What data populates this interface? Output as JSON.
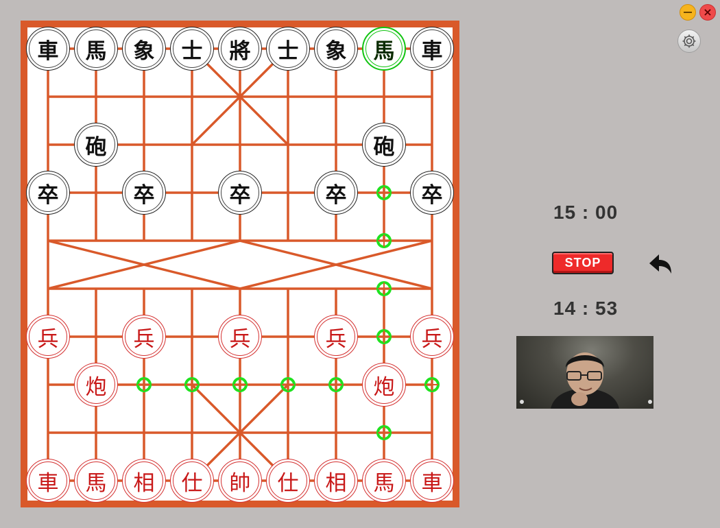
{
  "window": {
    "minimize_icon": "minus-icon",
    "close_icon": "x-icon",
    "settings_icon": "gear-icon"
  },
  "board": {
    "frame_color": "#d9592a",
    "background_color": "#ffffff",
    "line_color": "#d9592a",
    "columns": 9,
    "rows": 10
  },
  "pieces": [
    {
      "char": "車",
      "side": "black",
      "col": 0,
      "row": 0
    },
    {
      "char": "馬",
      "side": "black",
      "col": 1,
      "row": 0
    },
    {
      "char": "象",
      "side": "black",
      "col": 2,
      "row": 0
    },
    {
      "char": "士",
      "side": "black",
      "col": 3,
      "row": 0
    },
    {
      "char": "將",
      "side": "black",
      "col": 4,
      "row": 0
    },
    {
      "char": "士",
      "side": "black",
      "col": 5,
      "row": 0
    },
    {
      "char": "象",
      "side": "black",
      "col": 6,
      "row": 0
    },
    {
      "char": "馬",
      "side": "black",
      "col": 7,
      "row": 0,
      "selected": true
    },
    {
      "char": "車",
      "side": "black",
      "col": 8,
      "row": 0
    },
    {
      "char": "砲",
      "side": "black",
      "col": 1,
      "row": 2
    },
    {
      "char": "砲",
      "side": "black",
      "col": 7,
      "row": 2
    },
    {
      "char": "卒",
      "side": "black",
      "col": 0,
      "row": 3
    },
    {
      "char": "卒",
      "side": "black",
      "col": 2,
      "row": 3
    },
    {
      "char": "卒",
      "side": "black",
      "col": 4,
      "row": 3
    },
    {
      "char": "卒",
      "side": "black",
      "col": 6,
      "row": 3
    },
    {
      "char": "卒",
      "side": "black",
      "col": 8,
      "row": 3
    },
    {
      "char": "兵",
      "side": "red",
      "col": 0,
      "row": 6
    },
    {
      "char": "兵",
      "side": "red",
      "col": 2,
      "row": 6
    },
    {
      "char": "兵",
      "side": "red",
      "col": 4,
      "row": 6
    },
    {
      "char": "兵",
      "side": "red",
      "col": 6,
      "row": 6
    },
    {
      "char": "兵",
      "side": "red",
      "col": 8,
      "row": 6
    },
    {
      "char": "炮",
      "side": "red",
      "col": 1,
      "row": 7
    },
    {
      "char": "炮",
      "side": "red",
      "col": 7,
      "row": 7
    },
    {
      "char": "車",
      "side": "red",
      "col": 0,
      "row": 9
    },
    {
      "char": "馬",
      "side": "red",
      "col": 1,
      "row": 9
    },
    {
      "char": "相",
      "side": "red",
      "col": 2,
      "row": 9
    },
    {
      "char": "仕",
      "side": "red",
      "col": 3,
      "row": 9
    },
    {
      "char": "帥",
      "side": "red",
      "col": 4,
      "row": 9
    },
    {
      "char": "仕",
      "side": "red",
      "col": 5,
      "row": 9
    },
    {
      "char": "相",
      "side": "red",
      "col": 6,
      "row": 9
    },
    {
      "char": "馬",
      "side": "red",
      "col": 7,
      "row": 9
    },
    {
      "char": "車",
      "side": "red",
      "col": 8,
      "row": 9
    }
  ],
  "move_hints": [
    {
      "col": 7,
      "row": 3
    },
    {
      "col": 7,
      "row": 4
    },
    {
      "col": 7,
      "row": 5
    },
    {
      "col": 7,
      "row": 6
    },
    {
      "col": 2,
      "row": 7
    },
    {
      "col": 3,
      "row": 7
    },
    {
      "col": 4,
      "row": 7
    },
    {
      "col": 5,
      "row": 7
    },
    {
      "col": 6,
      "row": 7
    },
    {
      "col": 8,
      "row": 7
    },
    {
      "col": 7,
      "row": 8
    }
  ],
  "controls": {
    "top_timer": "15 : 00",
    "stop_label": "STOP",
    "bottom_timer": "14 : 53",
    "undo_icon": "undo-arrow-icon",
    "webcam_label": "webcam-video"
  }
}
